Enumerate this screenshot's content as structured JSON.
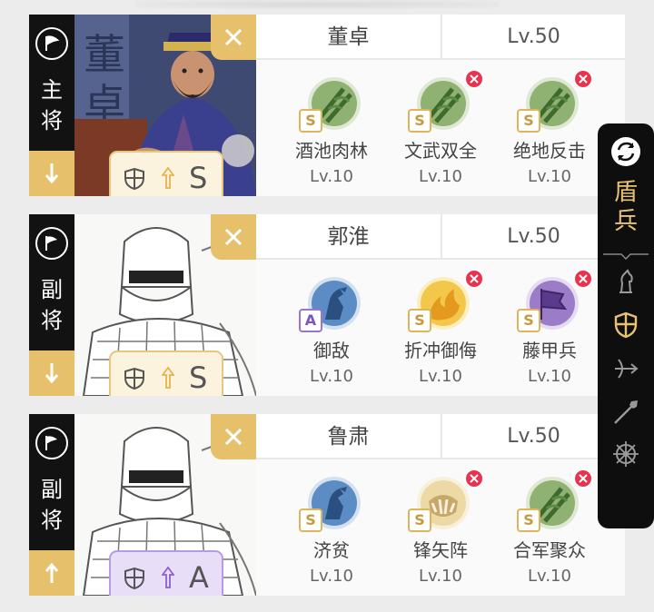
{
  "generals": [
    {
      "role": "主将",
      "role_chars": [
        "主",
        "将"
      ],
      "direction": "down",
      "portrait": "董卓",
      "name": "董卓",
      "level": "Lv.50",
      "troop_grade": "S",
      "badge_style": "gold",
      "skills": [
        {
          "name": "酒池肉林",
          "level": "Lv.10",
          "grade": "S",
          "icon": "green-bamboo",
          "removable": false
        },
        {
          "name": "文武双全",
          "level": "Lv.10",
          "grade": "S",
          "icon": "green-bamboo",
          "removable": true
        },
        {
          "name": "绝地反击",
          "level": "Lv.10",
          "grade": "S",
          "icon": "green-bamboo",
          "removable": true
        }
      ]
    },
    {
      "role": "副将",
      "role_chars": [
        "副",
        "将"
      ],
      "direction": "down",
      "portrait": "sketch-warrior",
      "name": "郭淮",
      "level": "Lv.50",
      "troop_grade": "S",
      "badge_style": "gold",
      "skills": [
        {
          "name": "御敌",
          "level": "Lv.10",
          "grade": "A",
          "icon": "blue-horse",
          "removable": false
        },
        {
          "name": "折冲御侮",
          "level": "Lv.10",
          "grade": "S",
          "icon": "yellow-fire",
          "removable": true
        },
        {
          "name": "藤甲兵",
          "level": "Lv.10",
          "grade": "S",
          "icon": "purple-banner",
          "removable": true
        }
      ]
    },
    {
      "role": "副将",
      "role_chars": [
        "副",
        "将"
      ],
      "direction": "up",
      "portrait": "sketch-warrior",
      "name": "鲁肃",
      "level": "Lv.50",
      "troop_grade": "A",
      "badge_style": "purple",
      "skills": [
        {
          "name": "济贫",
          "level": "Lv.10",
          "grade": "S",
          "icon": "blue-horse",
          "removable": false
        },
        {
          "name": "锋矢阵",
          "level": "Lv.10",
          "grade": "S",
          "icon": "cream-trap",
          "removable": true
        },
        {
          "name": "合军聚众",
          "level": "Lv.10",
          "grade": "S",
          "icon": "green-bamboo",
          "removable": true
        }
      ]
    }
  ],
  "sidepanel": {
    "title_chars": [
      "盾",
      "兵"
    ],
    "units": [
      "cavalry-icon",
      "shield-icon",
      "bow-icon",
      "spear-icon",
      "ship-wheel-icon"
    ],
    "selected": "shield-icon"
  },
  "colors": {
    "gold": "#e6c06a",
    "dark": "#121212",
    "delete_red": "#e8334e",
    "purple_badge": "#b69be2"
  }
}
